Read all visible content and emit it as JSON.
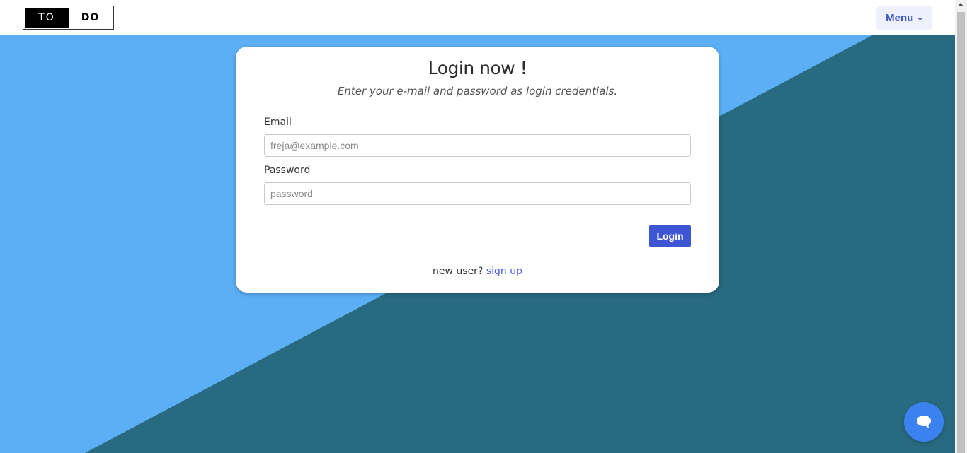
{
  "brand": {
    "left": "TO",
    "right": "DO"
  },
  "nav": {
    "menu_label": "Menu"
  },
  "login": {
    "title": "Login now !",
    "subtitle": "Enter your e-mail and password as login credentials.",
    "email_label": "Email",
    "email_placeholder": "freja@example.com",
    "password_label": "Password",
    "password_placeholder": "password",
    "submit_label": "Login",
    "signup_prompt": "new user?",
    "signup_link": "sign up"
  },
  "colors": {
    "background_light": "#5caff5",
    "background_dark": "#286a80",
    "primary": "#3e56d4"
  },
  "icons": {
    "chat": "chat-bubble-icon",
    "menu_chevron": "chevron-down-icon"
  }
}
